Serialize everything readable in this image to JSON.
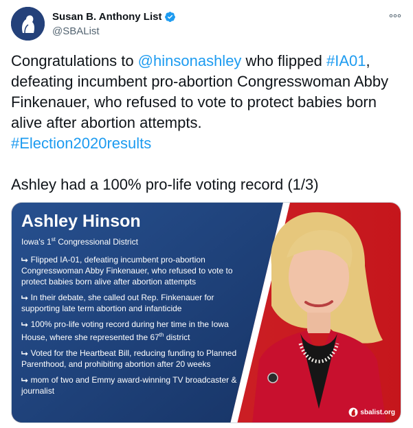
{
  "user": {
    "name": "Susan B. Anthony List",
    "handle": "@SBAList"
  },
  "tweet": {
    "line1_pre": "Congratulations to ",
    "mention": "@hinsonashley",
    "line1_mid": " who flipped ",
    "hashtag1": "#IA01",
    "line1_post": ",",
    "body": "defeating incumbent pro-abortion Congresswoman Abby Finkenauer, who refused to vote to protect babies born alive after abortion attempts.",
    "hashtag2": "#Election2020results",
    "second_paragraph": "Ashley had a 100% pro-life voting record (1/3)"
  },
  "card": {
    "name": "Ashley Hinson",
    "district_pre": "Iowa's 1",
    "district_sup": "st",
    "district_post": " Congressional District",
    "bullets": [
      "Flipped IA-01, defeating incumbent pro-abortion Congresswoman Abby Finkenauer, who refused to vote to protect babies born alive after abortion attempts",
      "In their debate, she called out Rep. Finkenauer for supporting late term abortion and infanticide",
      "Voted for the Heartbeat Bill, reducing funding to Planned Parenthood, and prohibiting abortion after 20 weeks",
      "mom of two and Emmy award-winning TV broadcaster & journalist"
    ],
    "bullet3_pre": "100% pro-life voting record during her time in the Iowa House, where she represented the 67",
    "bullet3_sup": "th",
    "bullet3_post": " district",
    "site": "sbalist.org"
  },
  "colors": {
    "link": "#1d9bf0",
    "card_blue": "#1f4487",
    "card_red": "#d2262b",
    "verified": "#1d9bf0"
  },
  "icons": {
    "verified": "verified-badge-icon",
    "more": "more-options-icon",
    "avatar": "sba-logo-avatar"
  }
}
